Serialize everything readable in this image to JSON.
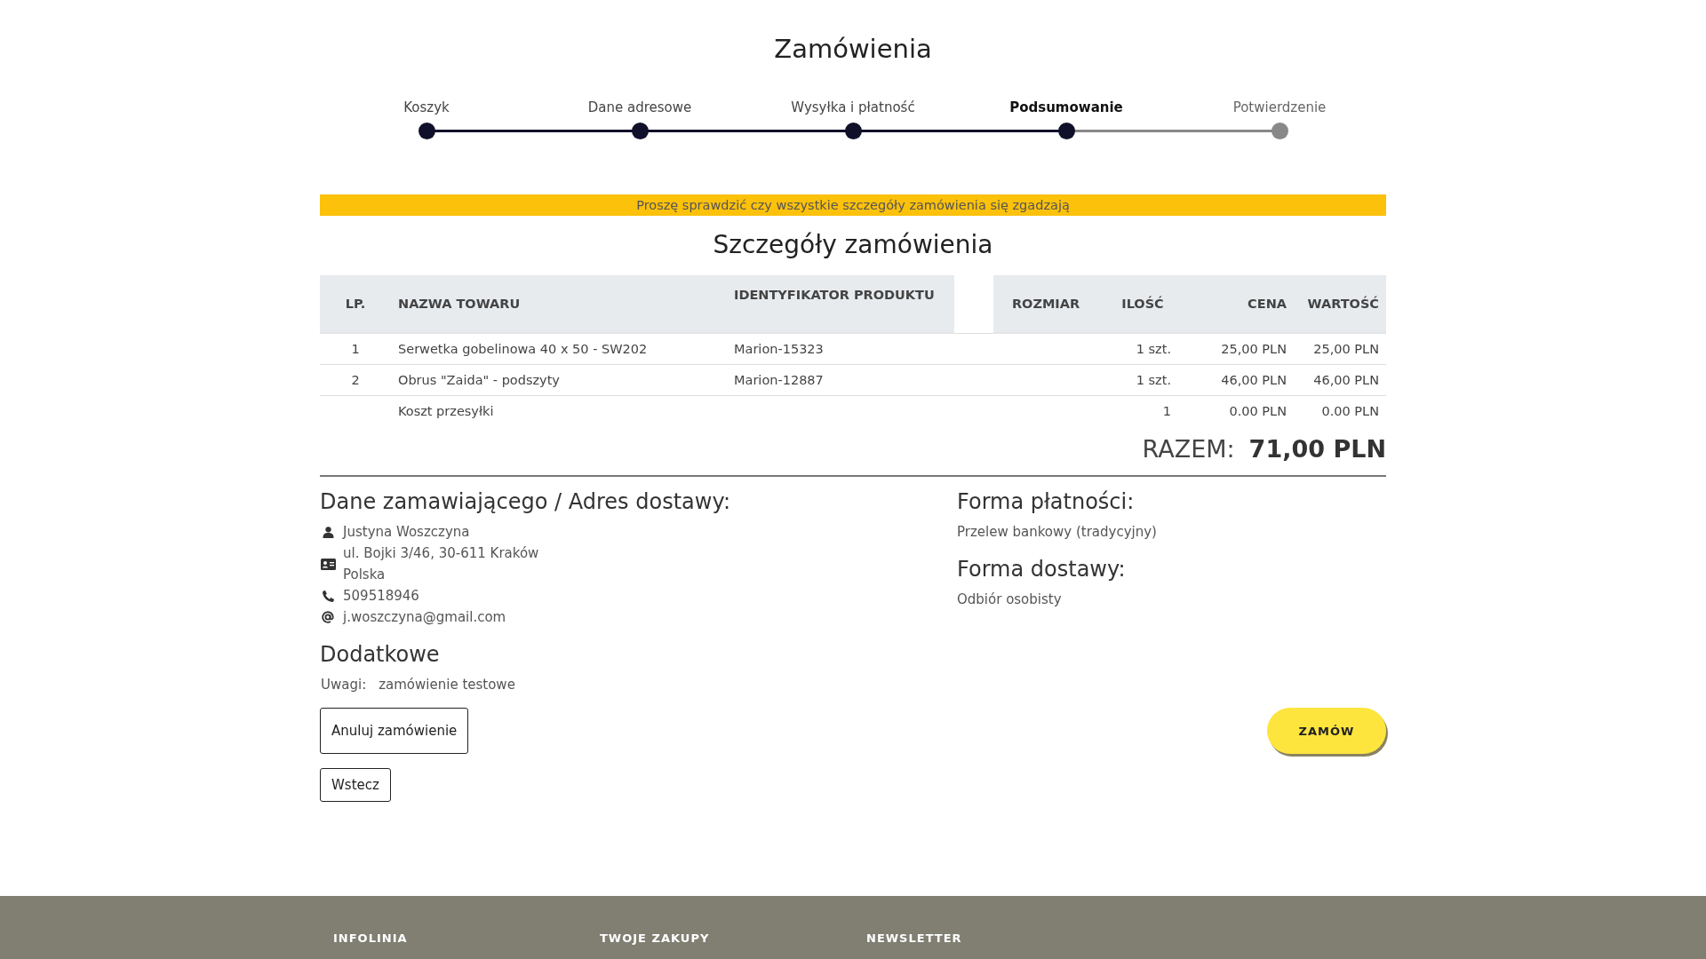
{
  "page_title": "Zamówienia",
  "steps": [
    {
      "label": "Koszyk",
      "completed": true,
      "selected": false
    },
    {
      "label": "Dane adresowe",
      "completed": true,
      "selected": false
    },
    {
      "label": "Wysyłka i płatność",
      "completed": true,
      "selected": false
    },
    {
      "label": "Podsumowanie",
      "completed": true,
      "selected": true
    },
    {
      "label": "Potwierdzenie",
      "completed": false,
      "selected": false
    }
  ],
  "notice": "Proszę sprawdzić czy wszystkie szczegóły zamówienia się zgadzają",
  "details_title": "Szczegóły zamówienia",
  "table": {
    "columns": [
      "LP.",
      "NAZWA TOWARU",
      "IDENTYFIKATOR PRODUKTU",
      "",
      "ROZMIAR",
      "ILOŚĆ",
      "CENA",
      "WARTOŚĆ"
    ],
    "rows": [
      [
        "1",
        "Serwetka gobelinowa 40 x 50 - SW202",
        "Marion-15323",
        "",
        "",
        "1 szt.",
        "25,00 PLN",
        "25,00 PLN"
      ],
      [
        "2",
        "Obrus \"Zaida\" - podszyty",
        "Marion-12887",
        "",
        "",
        "1 szt.",
        "46,00 PLN",
        "46,00 PLN"
      ],
      [
        "",
        "Koszt przesyłki",
        "",
        "",
        "",
        "1",
        "0.00 PLN",
        "0.00 PLN"
      ]
    ]
  },
  "total": {
    "label": "RAZEM:",
    "value": "71,00 PLN"
  },
  "customer": {
    "title": "Dane zamawiającego / Adres dostawy:",
    "lines": [
      {
        "kind": "person",
        "texts": [
          "Justyna Woszczyna"
        ]
      },
      {
        "kind": "address",
        "texts": [
          "ul. Bojki 3/46, 30-611 Kraków",
          "Polska"
        ]
      },
      {
        "kind": "phone",
        "texts": [
          "509518946"
        ]
      },
      {
        "kind": "email",
        "texts": [
          "j.woszczyna@gmail.com"
        ]
      }
    ]
  },
  "payment": {
    "title": "Forma płatności:",
    "value": "Przelew bankowy (tradycyjny)"
  },
  "delivery": {
    "title": "Forma dostawy:",
    "value": "Odbiór osobisty"
  },
  "extra": {
    "title": "Dodatkowe",
    "label": "Uwagi:",
    "value": "zamówienie testowe"
  },
  "buttons": {
    "cancel": "Anuluj zamówienie",
    "back": "Wstecz",
    "order": "ZAMÓW"
  },
  "footer": {
    "columns": [
      "INFOLINIA",
      "TWOJE ZAKUPY",
      "NEWSLETTER"
    ]
  }
}
